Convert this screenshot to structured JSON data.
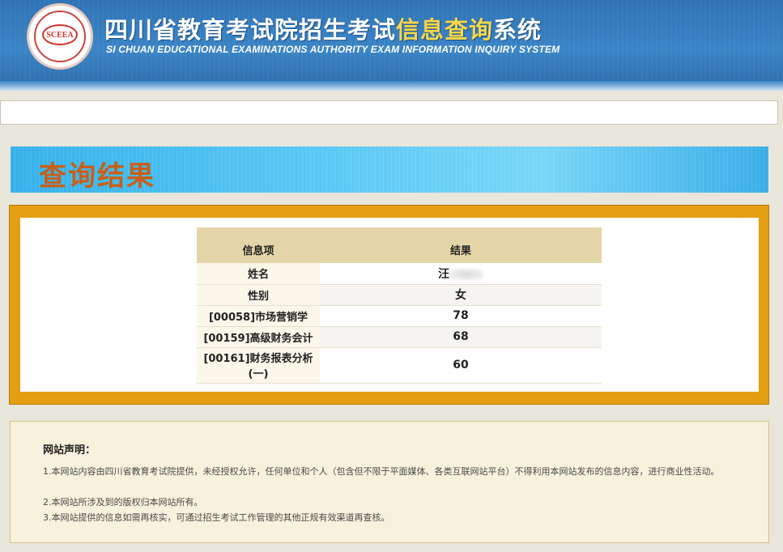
{
  "header": {
    "title_part1": "四川省教育考试院招生考试",
    "title_highlight": "信息查询",
    "title_part2": "系统",
    "subtitle": "SI CHUAN EDUCATIONAL EXAMINATIONS AUTHORITY EXAM INFORMATION INQUIRY SYSTEM",
    "logo_text": "SCEEA"
  },
  "banner": {
    "title": "查询结果"
  },
  "table": {
    "headers": [
      "信息项",
      "结果"
    ],
    "rows": [
      {
        "item": "姓名",
        "value": "汪"
      },
      {
        "item": "性别",
        "value": "女"
      },
      {
        "item": "[00058]市场营销学",
        "value": "78"
      },
      {
        "item": "[00159]高级财务会计",
        "value": "68"
      },
      {
        "item": "[00161]财务报表分析(一)",
        "value": "60"
      }
    ]
  },
  "notice": {
    "title": "网站声明：",
    "lines": [
      "1.本网站内容由四川省教育考试院提供，未经授权允许，任何单位和个人（包含但不限于平面媒体、各类互联网站平台）不得利用本网站发布的信息内容，进行商业性活动。",
      "2.本网站所涉及到的版权归本网站所有。",
      "3.本网站提供的信息如需再核实，可通过招生考试工作管理的其他正规有效渠道再查核。"
    ]
  },
  "colors": {
    "header_blue": "#2f73b5",
    "title_highlight": "#f6d64a",
    "banner_title": "#c85f16",
    "frame_orange": "#e39e12",
    "table_header": "#e4d5a8"
  }
}
